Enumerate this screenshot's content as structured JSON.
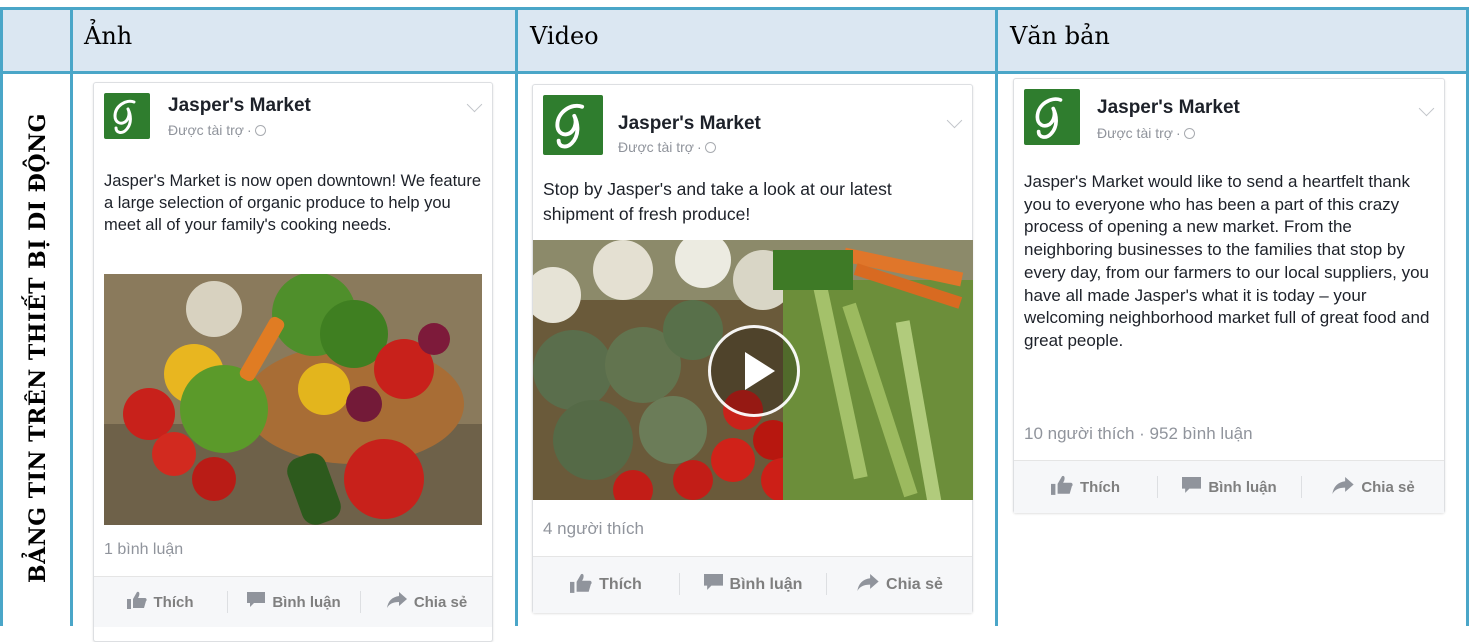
{
  "columns": {
    "photo": "Ảnh",
    "video": "Video",
    "text": "Văn bản"
  },
  "row_label": "BẢNG TIN TRÊN THIẾT BỊ DI ĐỘNG",
  "posts": [
    {
      "page_name": "Jasper's Market",
      "sponsored": "Được tài trợ",
      "body": "Jasper's Market is now open downtown! We feature a large selection of organic produce to help you meet all of your family's cooking needs.",
      "stats": "1 bình luận",
      "actions": {
        "like": "Thích",
        "comment": "Bình luận",
        "share": "Chia sẻ"
      }
    },
    {
      "page_name": "Jasper's Market",
      "sponsored": "Được tài trợ",
      "body": "Stop by Jasper's and take a look at our latest shipment of fresh produce!",
      "stats": "4 người thích",
      "actions": {
        "like": "Thích",
        "comment": "Bình luận",
        "share": "Chia sẻ"
      }
    },
    {
      "page_name": "Jasper's Market",
      "sponsored": "Được tài trợ",
      "body": "Jasper's Market would like to send a heartfelt thank you to everyone who has been a part of this crazy process of opening a new market. From the neighboring businesses to the families that stop by every day, from our farmers to our local suppliers, you have all made Jasper's what it is today – your welcoming neighborhood market full of great food and great people.",
      "stats": "10 người thích · 952 bình luận",
      "actions": {
        "like": "Thích",
        "comment": "Bình luận",
        "share": "Chia sẻ"
      }
    }
  ],
  "colors": {
    "header_bg": "#dbe7f2",
    "grid_line": "#4aa6c8",
    "logo_green": "#2f7d2e"
  },
  "icons": [
    "thumbs-up-icon",
    "comment-icon",
    "share-arrow-icon",
    "globe-icon",
    "chevron-down-icon",
    "play-icon"
  ]
}
